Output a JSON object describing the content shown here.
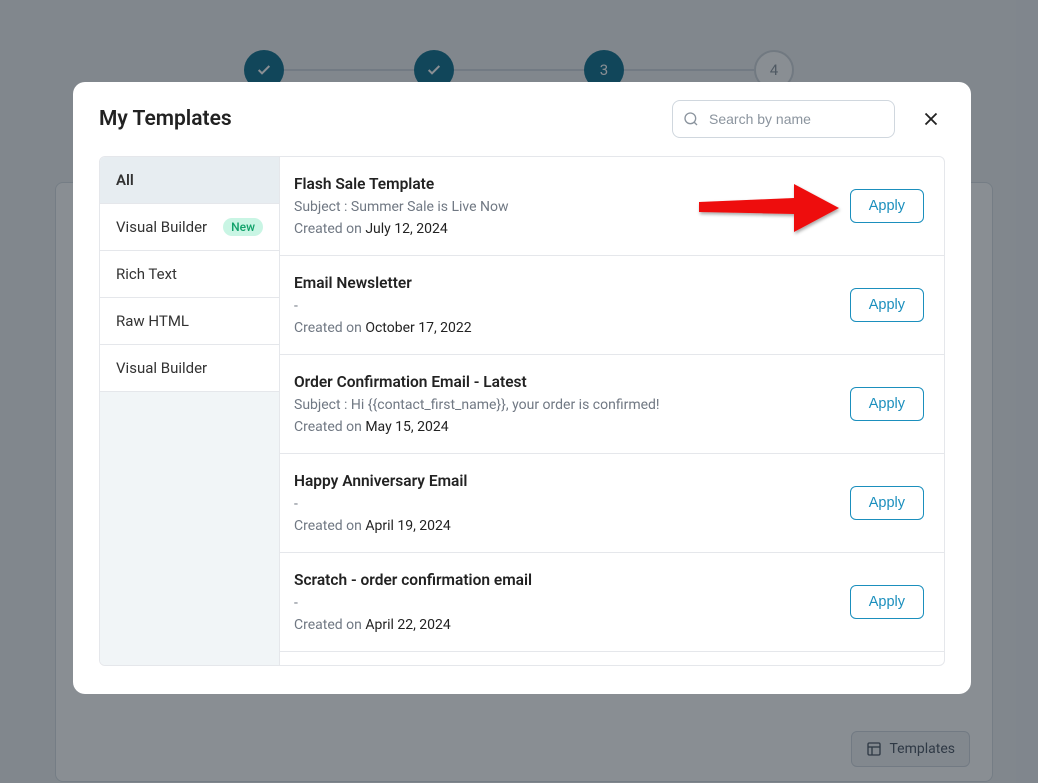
{
  "stepper": {
    "step3": "3",
    "step4": "4"
  },
  "bg": {
    "templates_btn": "Templates"
  },
  "modal": {
    "title": "My Templates",
    "search_placeholder": "Search by name"
  },
  "sidebar": {
    "items": [
      {
        "label": "All",
        "active": true
      },
      {
        "label": "Visual Builder",
        "active": false,
        "badge": "New"
      },
      {
        "label": "Rich Text",
        "active": false
      },
      {
        "label": "Raw HTML",
        "active": false
      },
      {
        "label": "Visual Builder",
        "active": false
      }
    ]
  },
  "templates": [
    {
      "title": "Flash Sale Template",
      "subject_prefix": "Subject : ",
      "subject": "Summer Sale is Live Now",
      "created_prefix": "Created on ",
      "created": "July 12, 2024",
      "apply": "Apply"
    },
    {
      "title": "Email Newsletter",
      "subject_prefix": "",
      "subject": "-",
      "created_prefix": "Created on ",
      "created": "October 17, 2022",
      "apply": "Apply"
    },
    {
      "title": "Order Confirmation Email - Latest",
      "subject_prefix": "Subject : ",
      "subject": "Hi {{contact_first_name}}, your order is confirmed!",
      "created_prefix": "Created on ",
      "created": "May 15, 2024",
      "apply": "Apply"
    },
    {
      "title": "Happy Anniversary Email",
      "subject_prefix": "",
      "subject": "-",
      "created_prefix": "Created on ",
      "created": "April 19, 2024",
      "apply": "Apply"
    },
    {
      "title": "Scratch - order confirmation email",
      "subject_prefix": "",
      "subject": "-",
      "created_prefix": "Created on ",
      "created": "April 22, 2024",
      "apply": "Apply"
    }
  ]
}
